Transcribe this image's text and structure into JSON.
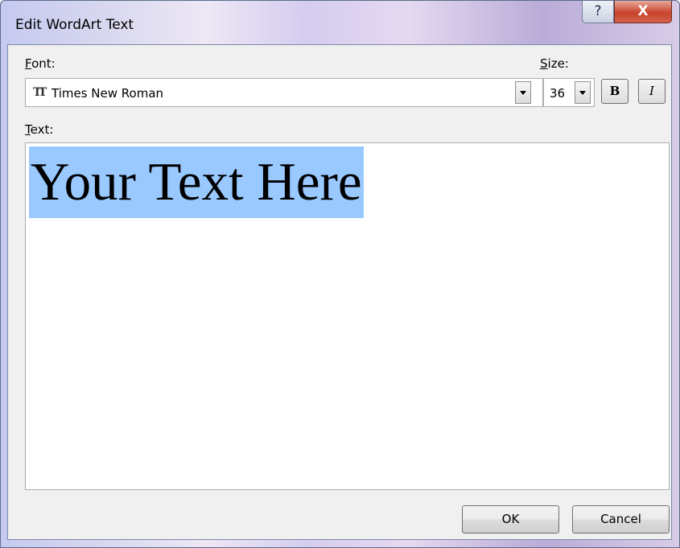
{
  "window": {
    "title": "Edit WordArt Text",
    "help_glyph": "?",
    "close_glyph": "X"
  },
  "font": {
    "label_key": "F",
    "label_rest": "ont:",
    "value": "Times New Roman",
    "icon": "truetype-font-icon",
    "icon_glyph": "TT"
  },
  "size": {
    "label_key": "S",
    "label_rest": "ize:",
    "value": "36"
  },
  "format": {
    "bold_glyph": "B",
    "italic_glyph": "I"
  },
  "text": {
    "label_key": "T",
    "label_rest": "ext:",
    "value": "Your Text Here",
    "selection_color": "#99c9ff"
  },
  "buttons": {
    "ok": "OK",
    "cancel": "Cancel"
  }
}
